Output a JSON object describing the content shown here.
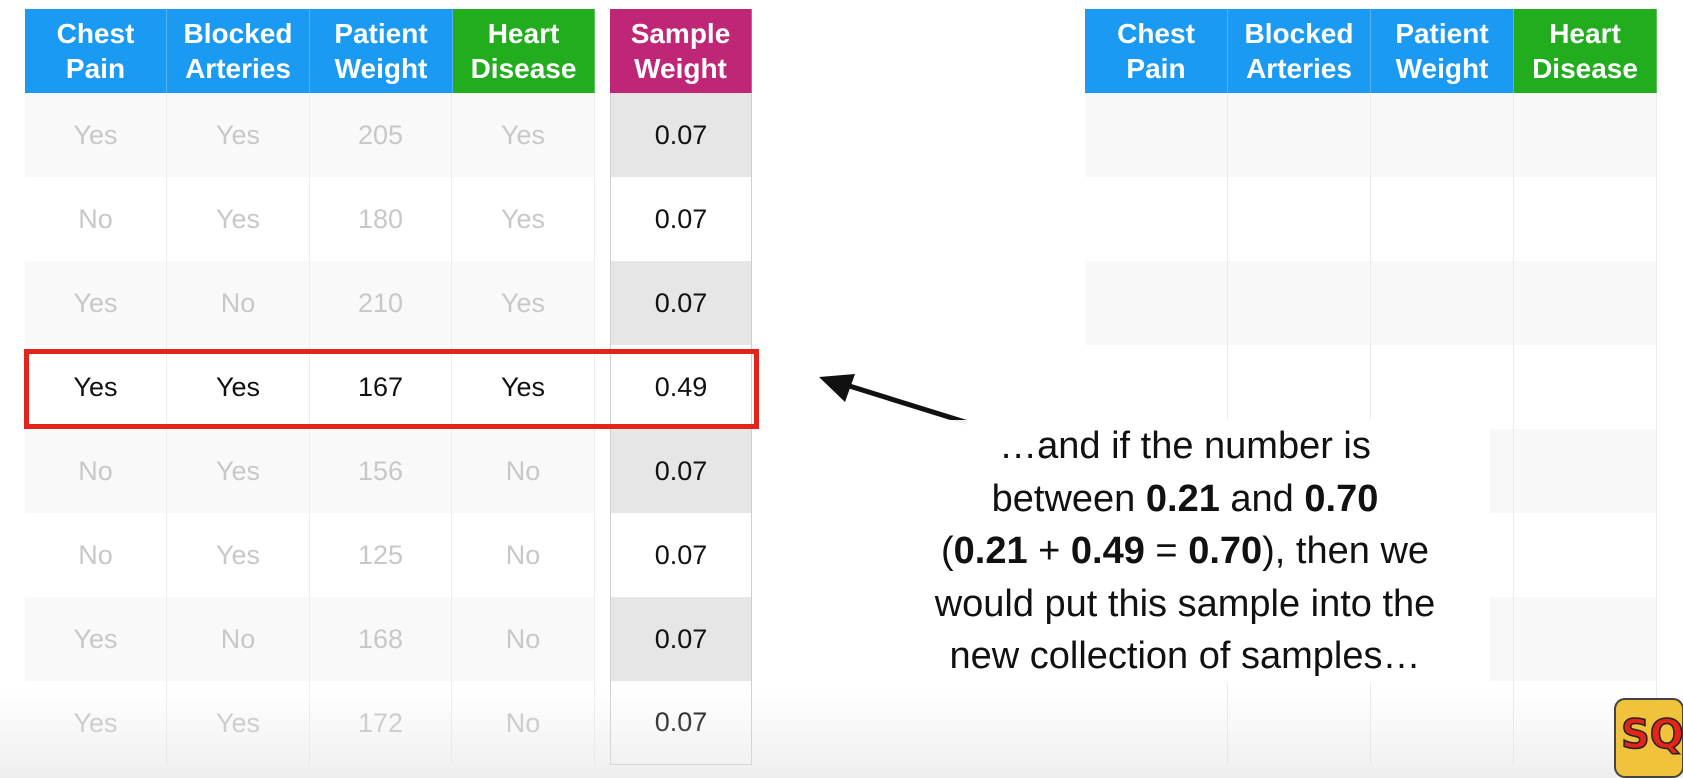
{
  "left_table": {
    "headers": [
      {
        "label": "Chest\nPain",
        "color": "#1a9af2"
      },
      {
        "label": "Blocked\nArteries",
        "color": "#1a9af2"
      },
      {
        "label": "Patient\nWeight",
        "color": "#1a9af2"
      },
      {
        "label": "Heart\nDisease",
        "color": "#22ad1f"
      }
    ],
    "sample_weight_header": {
      "label": "Sample\nWeight",
      "color": "#c02676"
    },
    "rows": [
      {
        "chest_pain": "Yes",
        "blocked_arteries": "Yes",
        "patient_weight": "205",
        "heart_disease": "Yes",
        "sample_weight": "0.07"
      },
      {
        "chest_pain": "No",
        "blocked_arteries": "Yes",
        "patient_weight": "180",
        "heart_disease": "Yes",
        "sample_weight": "0.07"
      },
      {
        "chest_pain": "Yes",
        "blocked_arteries": "No",
        "patient_weight": "210",
        "heart_disease": "Yes",
        "sample_weight": "0.07"
      },
      {
        "chest_pain": "Yes",
        "blocked_arteries": "Yes",
        "patient_weight": "167",
        "heart_disease": "Yes",
        "sample_weight": "0.49"
      },
      {
        "chest_pain": "No",
        "blocked_arteries": "Yes",
        "patient_weight": "156",
        "heart_disease": "No",
        "sample_weight": "0.07"
      },
      {
        "chest_pain": "No",
        "blocked_arteries": "Yes",
        "patient_weight": "125",
        "heart_disease": "No",
        "sample_weight": "0.07"
      },
      {
        "chest_pain": "Yes",
        "blocked_arteries": "No",
        "patient_weight": "168",
        "heart_disease": "No",
        "sample_weight": "0.07"
      },
      {
        "chest_pain": "Yes",
        "blocked_arteries": "Yes",
        "patient_weight": "172",
        "heart_disease": "No",
        "sample_weight": "0.07"
      }
    ],
    "highlighted_row_index": 3,
    "highlight_color": "#e3241b"
  },
  "right_table": {
    "headers": [
      {
        "label": "Chest\nPain",
        "color": "#1a9af2"
      },
      {
        "label": "Blocked\nArteries",
        "color": "#1a9af2"
      },
      {
        "label": "Patient\nWeight",
        "color": "#1a9af2"
      },
      {
        "label": "Heart\nDisease",
        "color": "#22ad1f"
      }
    ]
  },
  "annotation": {
    "line1": "…and if the number is",
    "line2_pre": "between ",
    "line2_a": "0.21",
    "line2_mid": " and ",
    "line2_b": "0.70",
    "line3_open": "(",
    "line3_a": "0.21",
    "line3_plus": " + ",
    "line3_b": "0.49",
    "line3_eq": " = ",
    "line3_c": "0.70",
    "line3_rest": "), then we",
    "line4": "would put this sample into the",
    "line5": "new collection of samples…"
  },
  "arrow_icon": "arrow-left-icon",
  "logo_icon": "statquest-logo-icon"
}
